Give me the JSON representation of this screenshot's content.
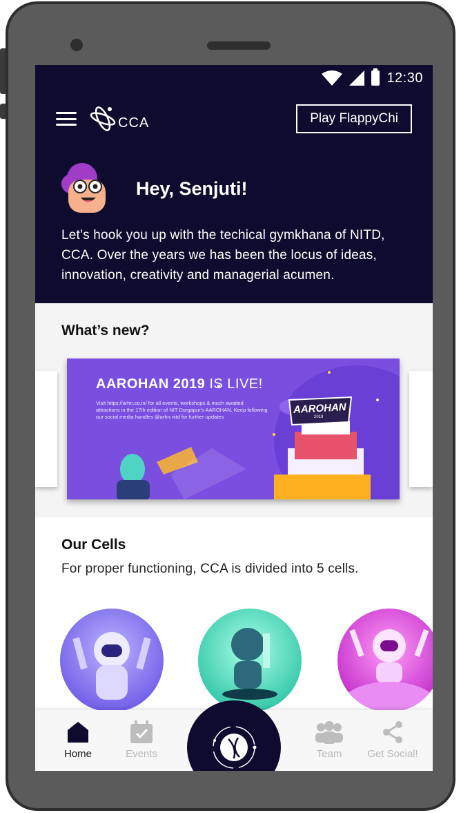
{
  "status_bar": {
    "time": "12:30",
    "icons": [
      "wifi-icon",
      "signal-icon",
      "battery-icon"
    ]
  },
  "top_bar": {
    "logo_text": "CCA",
    "play_button_label": "Play FlappyChi"
  },
  "greeting": {
    "title": "Hey, Senjuti!",
    "intro": "Let’s hook you up with the techical gymkhana of NITD, CCA. Over the years we has been the locus of ideas, innovation, creativity and managerial acumen."
  },
  "whats_new": {
    "title": "What’s new?",
    "banner": {
      "title_bold": "AAROHAN 2019",
      "title_regular": " IS LIVE!",
      "description": "Visit https://arhn.co.in/ for all events, workshops & much awaited attractions in the 17th edition of NIT Durgapur's AAROHAN. Keep following our social media handles @arhn.nitd for further updates",
      "logo_text": "AAROHAN",
      "logo_year": "2019"
    }
  },
  "cells": {
    "title": "Our Cells",
    "subtitle": "For proper functioning, CCA is divided into 5 cells."
  },
  "bottom_nav": {
    "items": [
      {
        "label": "Home",
        "icon": "home-icon",
        "active": true
      },
      {
        "label": "Events",
        "icon": "calendar-icon",
        "active": false
      },
      {
        "label": "Team",
        "icon": "team-icon",
        "active": false
      },
      {
        "label": "Get Social!",
        "icon": "share-icon",
        "active": false
      }
    ]
  },
  "colors": {
    "header_bg": "#0f0b2e",
    "banner_bg": "#7a4fe0",
    "cell1": "#7b6cf0",
    "cell2": "#22d6b0",
    "cell3": "#e32bd6"
  }
}
